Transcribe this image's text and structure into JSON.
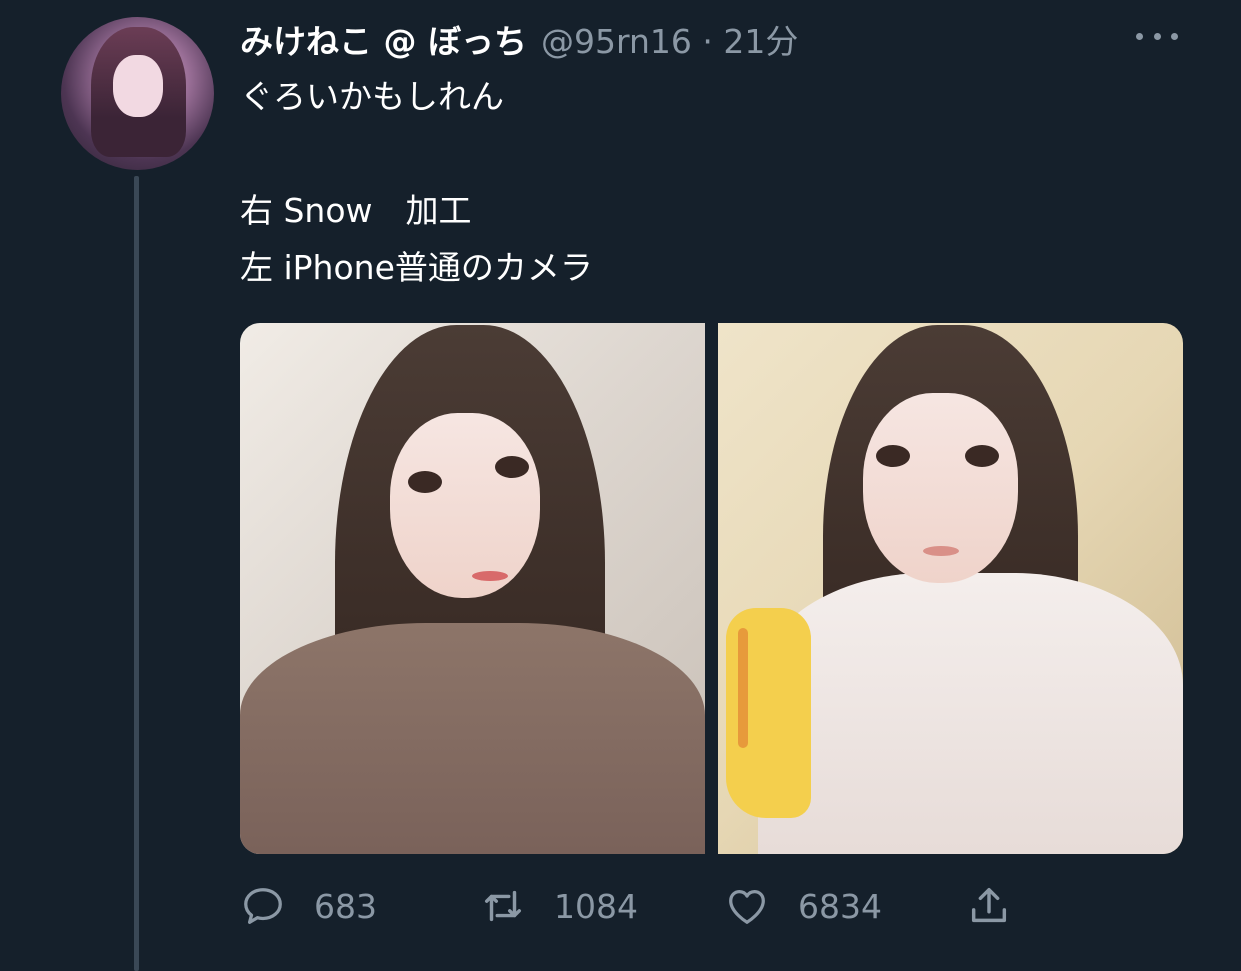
{
  "tweet": {
    "author_name": "みけねこ @ ぼっち",
    "handle_time": "@95rn16 · 21分",
    "text_lines": [
      "ぐろいかもしれん",
      "",
      "右 Snow　加工",
      "左 iPhone普通のカメラ"
    ]
  },
  "actions": {
    "reply_count": "683",
    "retweet_count": "1084",
    "like_count": "6834"
  },
  "icons": [
    "avatar",
    "more-icon",
    "reply-icon",
    "retweet-icon",
    "like-icon",
    "share-icon"
  ],
  "colors": {
    "background": "#15202b",
    "text": "#ffffff",
    "secondary": "#8b98a5"
  }
}
